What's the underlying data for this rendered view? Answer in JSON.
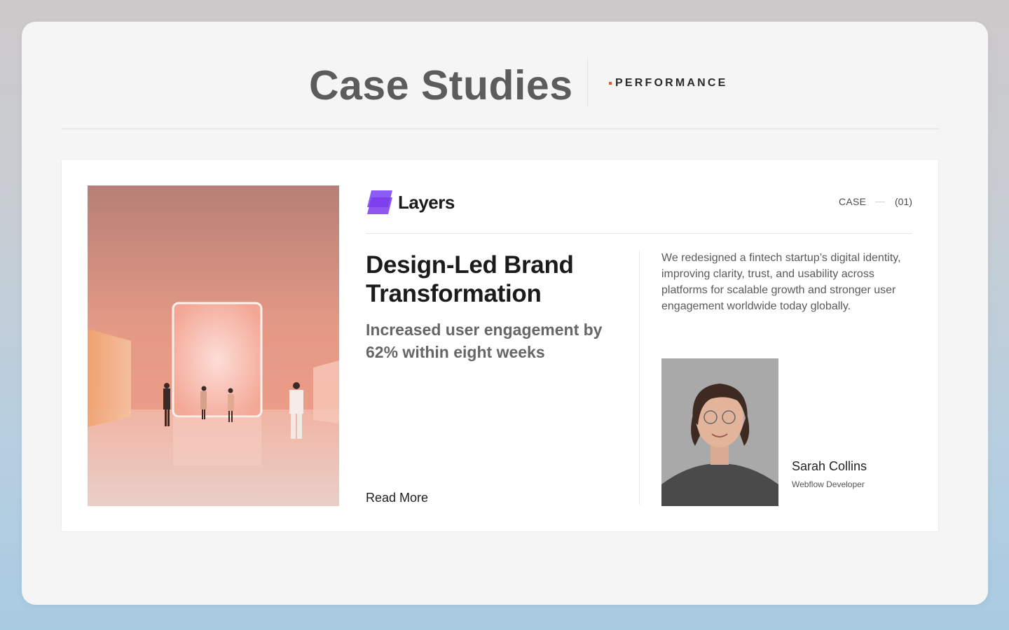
{
  "header": {
    "title": "Case Studies",
    "tag": "PERFORMANCE",
    "tag_color": "#f0531f"
  },
  "card": {
    "brand": {
      "name": "Layers",
      "icon": "layers-logo-icon",
      "color": "#8b5cf6"
    },
    "case_label": "CASE",
    "case_number": "(01)",
    "image": {
      "icon": "gallery-light-portal-image"
    },
    "headline": "Design-Led Brand Transformation",
    "subheadline": "Increased user engagement by 62% within eight weeks",
    "cta": "Read More",
    "description": "We redesigned a fintech startup’s digital identity, improving clarity, trust, and usability across platforms for scalable growth and stronger user engagement worldwide today globally.",
    "person": {
      "name": "Sarah Collins",
      "role": "Webflow Developer",
      "photo_icon": "portrait-photo"
    }
  }
}
